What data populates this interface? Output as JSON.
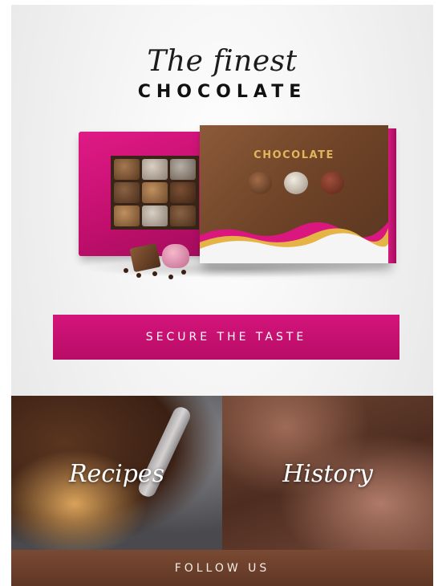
{
  "hero": {
    "script_title": "The finest",
    "main_title": "CHOCOLATE",
    "box_label": "CHOCOLATE",
    "image": "chocolate-gift-box"
  },
  "cta": {
    "label": "SECURE THE TASTE"
  },
  "tiles": [
    {
      "label": "Recipes",
      "image": "molten-chocolate-cake"
    },
    {
      "label": "History",
      "image": "chocolate-bark"
    }
  ],
  "footer": {
    "label": "FOLLOW US"
  },
  "colors": {
    "accent": "#c8106e",
    "footer": "#6b3f2a",
    "background": "#efefef"
  }
}
